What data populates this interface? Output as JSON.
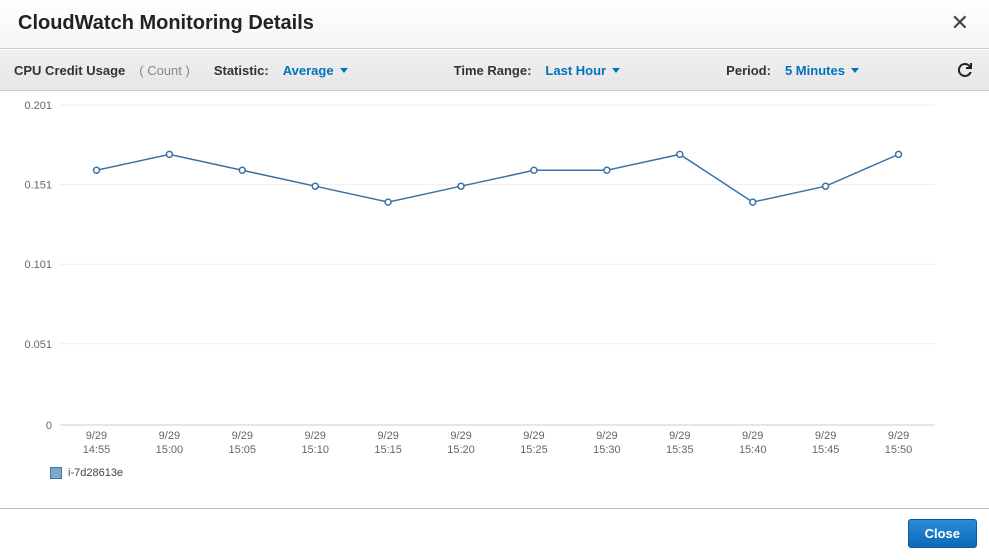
{
  "header": {
    "title": "CloudWatch Monitoring Details"
  },
  "toolbar": {
    "metric_name": "CPU Credit Usage",
    "metric_unit": "( Count )",
    "statistic_label": "Statistic:",
    "statistic_value": "Average",
    "timerange_label": "Time Range:",
    "timerange_value": "Last Hour",
    "period_label": "Period:",
    "period_value": "5 Minutes"
  },
  "legend": {
    "series0": "i-7d28613e"
  },
  "footer": {
    "close_label": "Close"
  },
  "chart_data": {
    "type": "line",
    "title": "",
    "xlabel": "",
    "ylabel": "",
    "ylim": [
      0,
      0.201
    ],
    "y_ticks": [
      "0",
      "0.051",
      "0.101",
      "0.151",
      "0.201"
    ],
    "categories": [
      "9/29 14:55",
      "9/29 15:00",
      "9/29 15:05",
      "9/29 15:10",
      "9/29 15:15",
      "9/29 15:20",
      "9/29 15:25",
      "9/29 15:30",
      "9/29 15:35",
      "9/29 15:40",
      "9/29 15:45",
      "9/29 15:50"
    ],
    "series": [
      {
        "name": "i-7d28613e",
        "values": [
          0.16,
          0.17,
          0.16,
          0.15,
          0.14,
          0.15,
          0.16,
          0.16,
          0.17,
          0.14,
          0.15,
          0.17
        ]
      }
    ]
  }
}
